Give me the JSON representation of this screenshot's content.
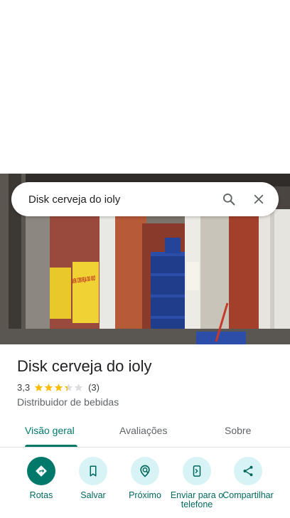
{
  "search": {
    "query": "Disk cerveja do ioly"
  },
  "place": {
    "name": "Disk cerveja do ioly",
    "rating": "3,3",
    "rating_value": 3.3,
    "review_count": "(3)",
    "category": "Distribuidor de bebidas"
  },
  "photo": {
    "sign_text_1": "DISK CERVEJA DO IOLY",
    "sign_text_2": "DISK CERVEJA DO IOLY"
  },
  "tabs": [
    {
      "label": "Visão geral",
      "active": true
    },
    {
      "label": "Avaliações",
      "active": false
    },
    {
      "label": "Sobre",
      "active": false
    }
  ],
  "actions": [
    {
      "label": "Rotas",
      "icon": "directions-icon"
    },
    {
      "label": "Salvar",
      "icon": "bookmark-icon"
    },
    {
      "label": "Próximo",
      "icon": "nearby-icon"
    },
    {
      "label": "Enviar para o telefone",
      "icon": "send-to-phone-icon"
    },
    {
      "label": "Compartilhar",
      "icon": "share-icon"
    }
  ],
  "colors": {
    "accent": "#00796b",
    "action_bg": "#d8f3f6",
    "star": "#fbbc04"
  }
}
